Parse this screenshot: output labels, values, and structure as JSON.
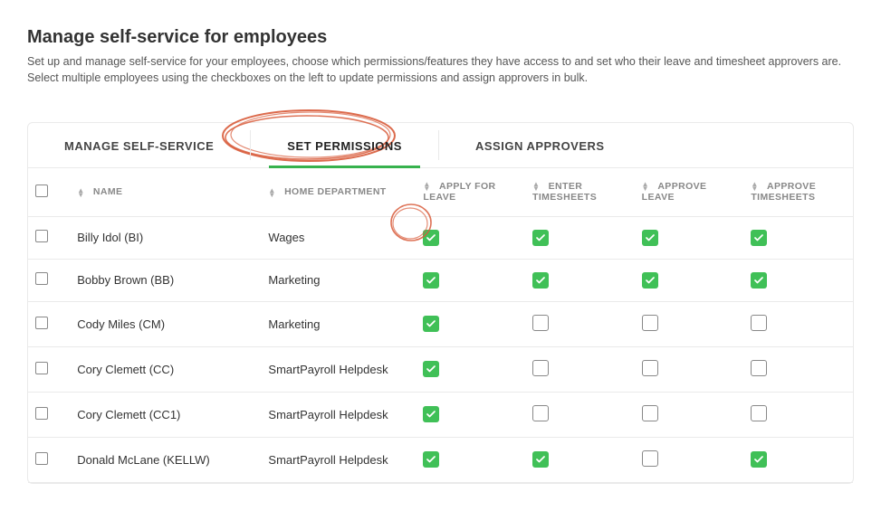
{
  "header": {
    "title": "Manage self-service for employees",
    "description": "Set up and manage self-service for your employees, choose which permissions/features they have access to and set who their leave and timesheet approvers are. Select multiple employees using the checkboxes on the left to update permissions and assign approvers in bulk."
  },
  "tabs": [
    {
      "label": "MANAGE SELF-SERVICE",
      "active": false
    },
    {
      "label": "SET PERMISSIONS",
      "active": true
    },
    {
      "label": "ASSIGN APPROVERS",
      "active": false
    }
  ],
  "columns": {
    "name": "NAME",
    "dept": "HOME DEPARTMENT",
    "apply_leave": "APPLY FOR LEAVE",
    "enter_ts": "ENTER TIMESHEETS",
    "approve_leave": "APPROVE LEAVE",
    "approve_ts": "APPROVE TIMESHEETS"
  },
  "rows": [
    {
      "name": "Billy Idol (BI)",
      "dept": "Wages",
      "apply_leave": true,
      "enter_ts": true,
      "approve_leave": true,
      "approve_ts": true
    },
    {
      "name": "Bobby Brown (BB)",
      "dept": "Marketing",
      "apply_leave": true,
      "enter_ts": true,
      "approve_leave": true,
      "approve_ts": true
    },
    {
      "name": "Cody Miles (CM)",
      "dept": "Marketing",
      "apply_leave": true,
      "enter_ts": false,
      "approve_leave": false,
      "approve_ts": false
    },
    {
      "name": "Cory Clemett (CC)",
      "dept": "SmartPayroll Helpdesk",
      "apply_leave": true,
      "enter_ts": false,
      "approve_leave": false,
      "approve_ts": false
    },
    {
      "name": "Cory Clemett (CC1)",
      "dept": "SmartPayroll Helpdesk",
      "apply_leave": true,
      "enter_ts": false,
      "approve_leave": false,
      "approve_ts": false
    },
    {
      "name": "Donald McLane (KELLW)",
      "dept": "SmartPayroll Helpdesk",
      "apply_leave": true,
      "enter_ts": true,
      "approve_leave": false,
      "approve_ts": true
    }
  ],
  "annotation": {
    "circled_tab": "SET PERMISSIONS",
    "circled_cell": {
      "row": 0,
      "col": "apply_leave"
    },
    "color": "#d85b3a"
  }
}
